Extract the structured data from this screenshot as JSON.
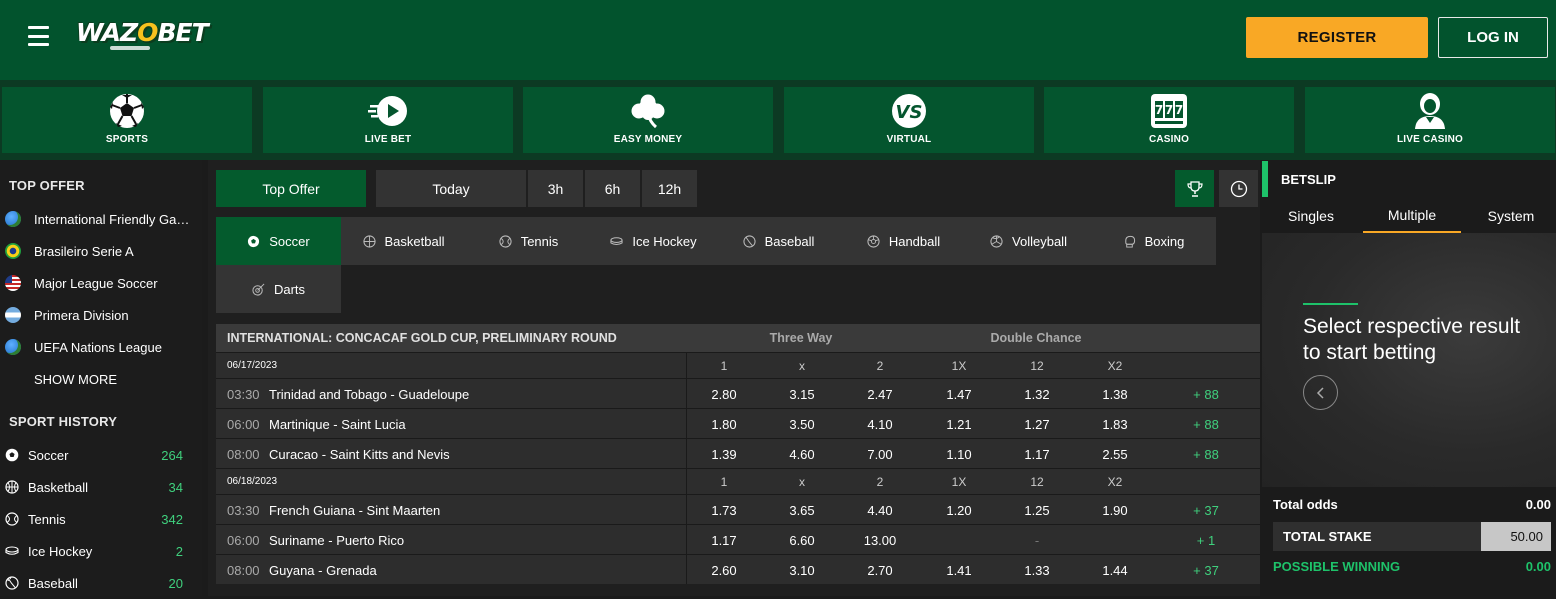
{
  "header": {
    "logo_text": "WAZOBET",
    "register_label": "REGISTER",
    "login_label": "LOG IN"
  },
  "categories": [
    {
      "label": "SPORTS",
      "icon": "soccer-ball-icon",
      "active": true
    },
    {
      "label": "LIVE BET",
      "icon": "live-play-icon",
      "active": false
    },
    {
      "label": "EASY MONEY",
      "icon": "clover-icon",
      "active": false
    },
    {
      "label": "VIRTUAL",
      "icon": "vs-icon",
      "active": false
    },
    {
      "label": "CASINO",
      "icon": "slot-machine-icon",
      "active": false
    },
    {
      "label": "LIVE CASINO",
      "icon": "dealer-icon",
      "active": false
    }
  ],
  "left_panel": {
    "top_offer_title": "TOP OFFER",
    "top_offer_items": [
      {
        "label": "International Friendly Games",
        "flag": "world"
      },
      {
        "label": "Brasileiro Serie A",
        "flag": "brazil"
      },
      {
        "label": "Major League Soccer",
        "flag": "usa"
      },
      {
        "label": "Primera Division",
        "flag": "argentina"
      },
      {
        "label": "UEFA Nations League",
        "flag": "world"
      }
    ],
    "show_more": "SHOW MORE",
    "sport_history_title": "SPORT HISTORY",
    "sport_history": [
      {
        "label": "Soccer",
        "count": "264",
        "icon": "soccer-icon"
      },
      {
        "label": "Basketball",
        "count": "34",
        "icon": "basketball-icon"
      },
      {
        "label": "Tennis",
        "count": "342",
        "icon": "tennis-icon"
      },
      {
        "label": "Ice Hockey",
        "count": "2",
        "icon": "ice-hockey-icon"
      },
      {
        "label": "Baseball",
        "count": "20",
        "icon": "baseball-icon"
      }
    ]
  },
  "timeframe": {
    "top_offer": "Top Offer",
    "today": "Today",
    "h3": "3h",
    "h6": "6h",
    "h12": "12h"
  },
  "sports_tabs": [
    {
      "label": "Soccer",
      "icon": "soccer-icon",
      "active": true
    },
    {
      "label": "Basketball",
      "icon": "basketball-icon",
      "active": false
    },
    {
      "label": "Tennis",
      "icon": "tennis-icon",
      "active": false
    },
    {
      "label": "Ice Hockey",
      "icon": "ice-hockey-icon",
      "active": false
    },
    {
      "label": "Baseball",
      "icon": "baseball-icon",
      "active": false
    },
    {
      "label": "Handball",
      "icon": "handball-icon",
      "active": false
    },
    {
      "label": "Volleyball",
      "icon": "volleyball-icon",
      "active": false
    },
    {
      "label": "Boxing",
      "icon": "boxing-icon",
      "active": false
    },
    {
      "label": "Darts",
      "icon": "darts-icon",
      "active": false
    }
  ],
  "odds_table": {
    "title": "INTERNATIONAL: CONCACAF GOLD CUP, PRELIMINARY ROUND",
    "group_three_way": "Three Way",
    "group_double_chance": "Double Chance",
    "columns": [
      "1",
      "x",
      "2",
      "1X",
      "12",
      "X2"
    ],
    "days": [
      {
        "date": "06/17/2023",
        "matches": [
          {
            "time": "03:30",
            "teams": "Trinidad and Tobago - Guadeloupe",
            "odds": [
              "2.80",
              "3.15",
              "2.47",
              "1.47",
              "1.32",
              "1.38"
            ],
            "more": "+ 88"
          },
          {
            "time": "06:00",
            "teams": "Martinique - Saint Lucia",
            "odds": [
              "1.80",
              "3.50",
              "4.10",
              "1.21",
              "1.27",
              "1.83"
            ],
            "more": "+ 88"
          },
          {
            "time": "08:00",
            "teams": "Curacao - Saint Kitts and Nevis",
            "odds": [
              "1.39",
              "4.60",
              "7.00",
              "1.10",
              "1.17",
              "2.55"
            ],
            "more": "+ 88"
          }
        ]
      },
      {
        "date": "06/18/2023",
        "matches": [
          {
            "time": "03:30",
            "teams": "French Guiana - Sint Maarten",
            "odds": [
              "1.73",
              "3.65",
              "4.40",
              "1.20",
              "1.25",
              "1.90"
            ],
            "more": "+ 37"
          },
          {
            "time": "06:00",
            "teams": "Suriname - Puerto Rico",
            "odds": [
              "1.17",
              "6.60",
              "13.00",
              "",
              "-",
              ""
            ],
            "more": "+ 1"
          },
          {
            "time": "08:00",
            "teams": "Guyana - Grenada",
            "odds": [
              "2.60",
              "3.10",
              "2.70",
              "1.41",
              "1.33",
              "1.44"
            ],
            "more": "+ 37"
          }
        ]
      }
    ]
  },
  "betslip": {
    "title": "BETSLIP",
    "tabs": [
      "Singles",
      "Multiple",
      "System"
    ],
    "active_tab": "Multiple",
    "message": "Select respective result to start betting",
    "total_odds_label": "Total odds",
    "total_odds_value": "0.00",
    "total_stake_label": "TOTAL STAKE",
    "total_stake_value": "50.00",
    "possible_winning_label": "POSSIBLE WINNING",
    "possible_winning_value": "0.00"
  },
  "colors": {
    "brand_green": "#02532d",
    "accent_orange": "#f9a825",
    "positive_green": "#3fd07d"
  }
}
